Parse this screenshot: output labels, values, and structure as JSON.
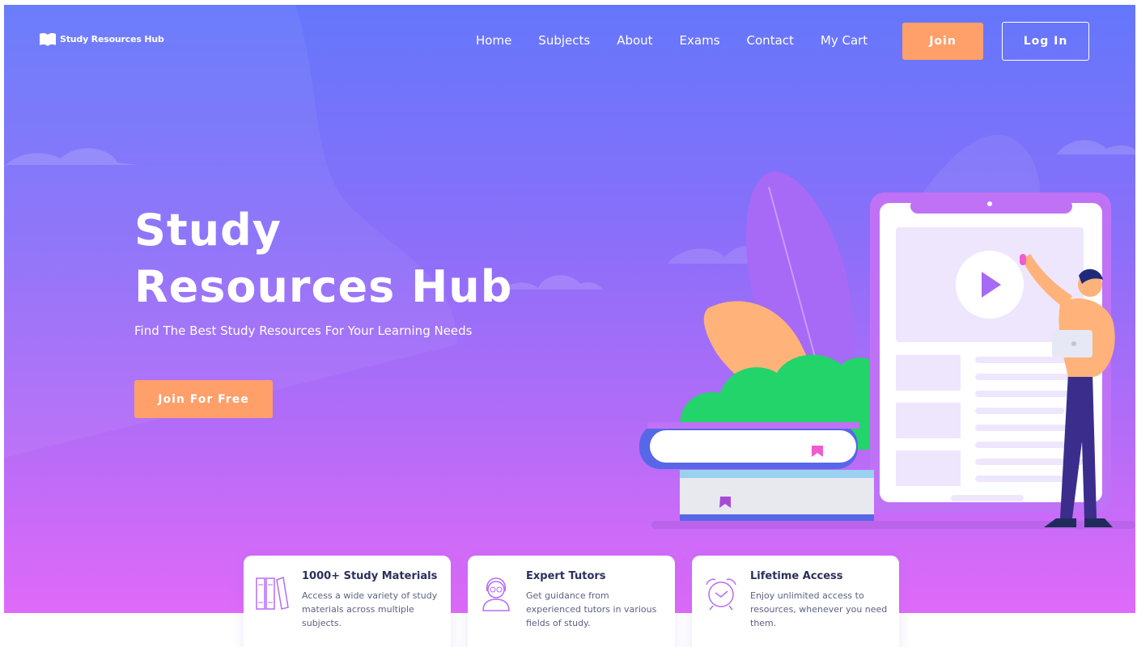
{
  "brand": {
    "name": "Study Resources Hub",
    "logo_icon": "book-icon"
  },
  "nav": {
    "items": [
      "Home",
      "Subjects",
      "About",
      "Exams",
      "Contact",
      "My Cart"
    ],
    "join_label": "Join",
    "login_label": "Log In"
  },
  "hero": {
    "title": "Study Resources Hub",
    "subtitle": "Find The Best Study Resources For Your Learning Needs",
    "cta_label": "Join For Free"
  },
  "features": [
    {
      "icon": "books-icon",
      "title": "1000+ Study Materials",
      "desc": "Access a wide variety of study materials across multiple subjects."
    },
    {
      "icon": "tutor-icon",
      "title": "Expert Tutors",
      "desc": "Get guidance from experienced tutors in various fields of study."
    },
    {
      "icon": "alarm-clock-icon",
      "title": "Lifetime Access",
      "desc": "Enjoy unlimited access to resources, whenever you need them."
    }
  ],
  "colors": {
    "accent": "#ff9f6a",
    "gradient_top": "#6477fb",
    "gradient_bottom": "#e06af9",
    "card_title": "#2c2f5b"
  }
}
